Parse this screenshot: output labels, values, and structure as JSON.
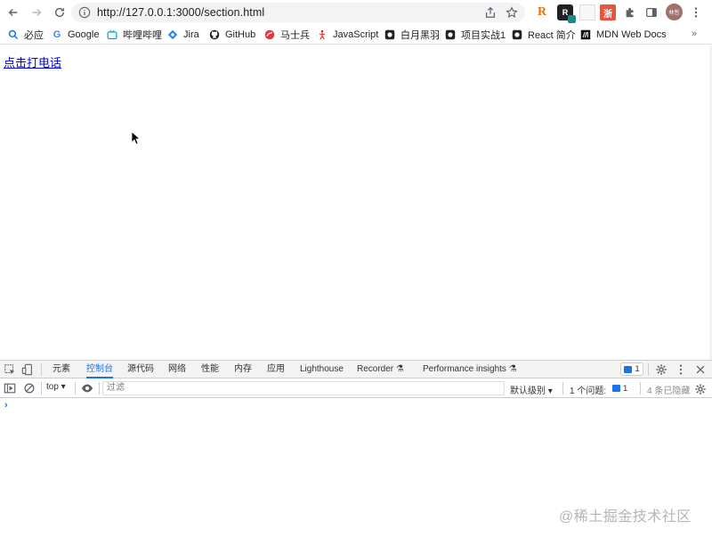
{
  "browser": {
    "url": "http://127.0.0.1:3000/section.html",
    "avatar_text": "林哲"
  },
  "extensions": {
    "r_label": "R",
    "r2_label": "R",
    "zhe_label": "浙"
  },
  "bookmarks": [
    {
      "label": "必应",
      "icon": "search-icon"
    },
    {
      "label": "Google",
      "icon": "google-icon"
    },
    {
      "label": "哔哩哔哩",
      "icon": "bilibili-icon"
    },
    {
      "label": "Jira",
      "icon": "jira-icon"
    },
    {
      "label": "GitHub",
      "icon": "github-icon"
    },
    {
      "label": "马士兵",
      "icon": "mashibing-icon"
    },
    {
      "label": "JavaScript",
      "icon": "javascript-icon"
    },
    {
      "label": "白月黑羽",
      "icon": "baiyue-icon"
    },
    {
      "label": "项目实战1",
      "icon": "project-icon"
    },
    {
      "label": "React 简介",
      "icon": "react-icon"
    },
    {
      "label": "MDN Web Docs",
      "icon": "mdn-icon"
    }
  ],
  "bookmarks_overflow": "»",
  "page": {
    "link_text": "点击打电话"
  },
  "devtools": {
    "tabs": [
      "元素",
      "控制台",
      "源代码",
      "网络",
      "性能",
      "内存",
      "应用",
      "Lighthouse",
      "Recorder",
      "Performance insights"
    ],
    "active_tab": "控制台",
    "issues_badge": "1",
    "context": "top",
    "filter_placeholder": "过滤",
    "levels_label": "默认级别",
    "issues_label": "1 个问题:",
    "issues_chip_count": "1",
    "hidden_label": "4 条已隐藏",
    "prompt": "›"
  },
  "watermark": "@稀土掘金技术社区",
  "colors": {
    "link": "#0000ee",
    "devtools_accent": "#1a73e8"
  }
}
